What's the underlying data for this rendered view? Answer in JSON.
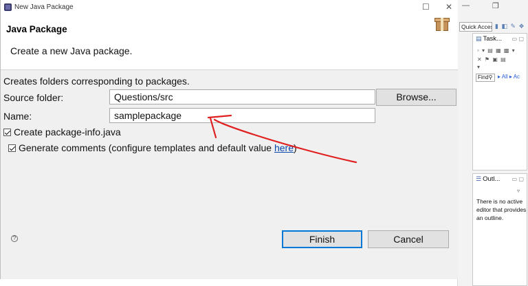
{
  "window": {
    "title": "New Java Package"
  },
  "header": {
    "title": "Java Package",
    "description": "Create a new Java package."
  },
  "content": {
    "intro": "Creates folders corresponding to packages.",
    "source_folder_label": "Source folder:",
    "source_folder_value": "Questions/src",
    "browse_label": "Browse...",
    "name_label": "Name:",
    "name_value": "samplepackage",
    "create_package_info_label": "Create package-info.java",
    "create_package_info_checked": true,
    "generate_comments_label": "Generate comments (configure templates and default value ",
    "generate_comments_link": "here",
    "generate_comments_suffix": ")",
    "generate_comments_checked": true
  },
  "footer": {
    "finish_label": "Finish",
    "cancel_label": "Cancel"
  },
  "ide": {
    "quick_access": "Quick Access",
    "tasks_tab": "Task...",
    "find_placeholder": "Find",
    "find_all": "All",
    "find_activate": "Ac",
    "outline_tab": "Outl...",
    "outline_message": "There is no active editor that provides an outline."
  },
  "colors": {
    "annotation_red": "#e02020",
    "finish_focus": "#0078d7",
    "link": "#0645ad"
  },
  "icons": {
    "title": "eclipse-dialog-icon",
    "header": "package-box-icon",
    "help": "help-icon"
  }
}
